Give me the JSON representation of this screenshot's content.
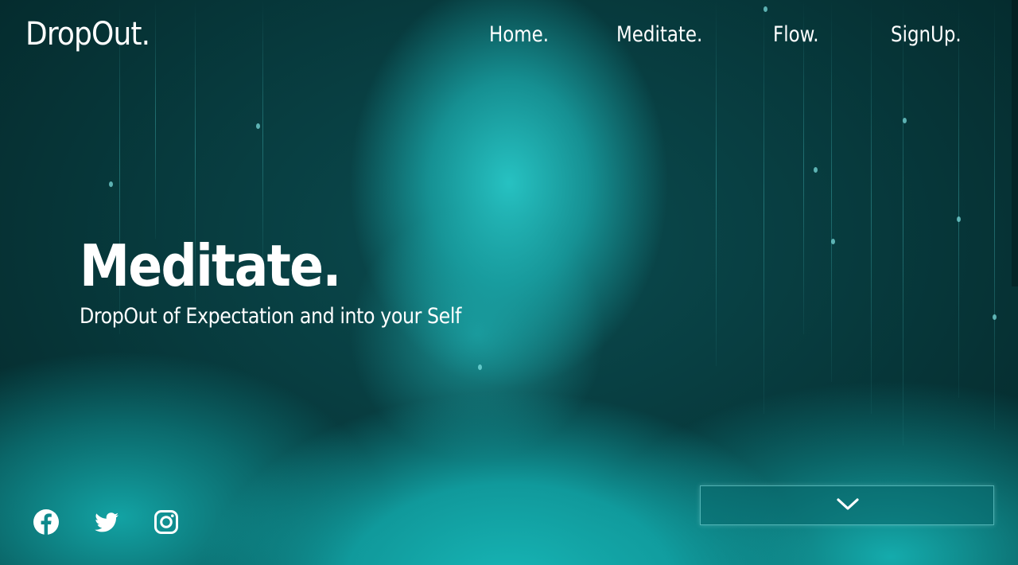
{
  "brand": {
    "logo_text": "DropOut."
  },
  "nav": {
    "items": [
      {
        "label": "Home."
      },
      {
        "label": "Meditate."
      },
      {
        "label": "Flow."
      },
      {
        "label": "SignUp."
      }
    ]
  },
  "hero": {
    "title": "Meditate.",
    "subtitle": "DropOut of Expectation and into your Self"
  },
  "socials": [
    {
      "icon": "facebook-icon"
    },
    {
      "icon": "twitter-icon"
    },
    {
      "icon": "instagram-icon"
    }
  ],
  "scroll_button": {
    "icon": "chevron-down-icon"
  },
  "colors": {
    "text": "#ffffff",
    "background_dark": "#052a2c",
    "accent_teal": "#1ab5b6"
  }
}
